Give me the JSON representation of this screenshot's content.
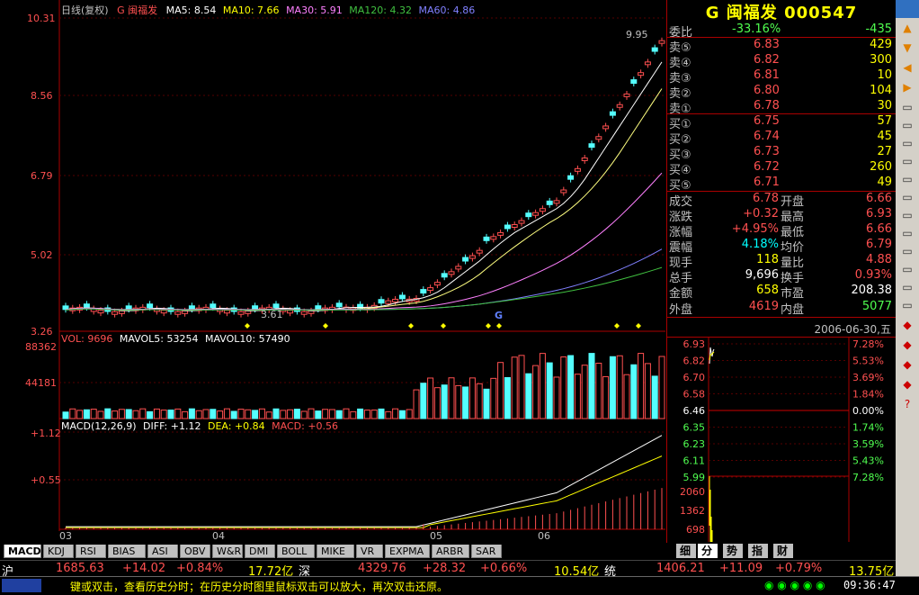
{
  "kline_header": {
    "period": "日线(复权)",
    "name": "G 闽福发",
    "ma5": "MA5: 8.54",
    "ma10": "MA10: 7.66",
    "ma30": "MA30: 5.91",
    "ma120": "MA120: 4.32",
    "ma60": "MA60: 4.86"
  },
  "price_axis": [
    "10.31",
    "8.56",
    "6.79",
    "5.02",
    "3.26"
  ],
  "annotations": {
    "high": "9.95",
    "low": "3.61",
    "g_mark": "G"
  },
  "vol_header": {
    "vol": "VOL: 9696",
    "mavol5": "MAVOL5: 53254",
    "mavol10": "MAVOL10: 57490"
  },
  "vol_axis": [
    "88362",
    "44181"
  ],
  "macd_header": {
    "title": "MACD(12,26,9)",
    "diff": "DIFF: +1.12",
    "dea": "DEA: +0.84",
    "macd": "MACD: +0.56"
  },
  "macd_axis": [
    "+1.12",
    "+0.55"
  ],
  "date_axis": [
    "03",
    "04",
    "05",
    "06"
  ],
  "indicator_tabs": [
    "MACD",
    "KDJ",
    "RSI",
    "BIAS",
    "ASI",
    "OBV",
    "W&R",
    "DMI",
    "BOLL",
    "MIKE",
    "VR",
    "EXPMA",
    "ARBR",
    "SAR"
  ],
  "quote": {
    "title": "G 闽福发 000547",
    "weibi": {
      "label": "委比",
      "value": "-33.16%",
      "diff": "-435"
    },
    "asks": [
      {
        "label": "卖⑤",
        "price": "6.83",
        "vol": "429"
      },
      {
        "label": "卖④",
        "price": "6.82",
        "vol": "300"
      },
      {
        "label": "卖③",
        "price": "6.81",
        "vol": "10"
      },
      {
        "label": "卖②",
        "price": "6.80",
        "vol": "104"
      },
      {
        "label": "卖①",
        "price": "6.78",
        "vol": "30"
      }
    ],
    "bids": [
      {
        "label": "买①",
        "price": "6.75",
        "vol": "57"
      },
      {
        "label": "买②",
        "price": "6.74",
        "vol": "45"
      },
      {
        "label": "买③",
        "price": "6.73",
        "vol": "27"
      },
      {
        "label": "买④",
        "price": "6.72",
        "vol": "260"
      },
      {
        "label": "买⑤",
        "price": "6.71",
        "vol": "49"
      }
    ],
    "stats": [
      {
        "l1": "成交",
        "v1": "6.78",
        "l2": "开盘",
        "v2": "6.66"
      },
      {
        "l1": "涨跌",
        "v1": "+0.32",
        "l2": "最高",
        "v2": "6.93"
      },
      {
        "l1": "涨幅",
        "v1": "+4.95%",
        "l2": "最低",
        "v2": "6.66"
      },
      {
        "l1": "震幅",
        "v1": "4.18%",
        "l2": "均价",
        "v2": "6.79"
      },
      {
        "l1": "现手",
        "v1": "118",
        "l2": "量比",
        "v2": "4.88"
      },
      {
        "l1": "总手",
        "v1": "9,696",
        "l2": "换手",
        "v2": "0.93%"
      },
      {
        "l1": "金额",
        "v1": "658",
        "l2": "市盈",
        "v2": "208.38"
      }
    ],
    "outer": {
      "l1": "外盘",
      "v1": "4619",
      "l2": "内盘",
      "v2": "5077"
    }
  },
  "mini_chart": {
    "date": "2006-06-30,五",
    "prices": [
      "6.93",
      "6.82",
      "6.70",
      "6.58",
      "6.46",
      "6.35",
      "6.23",
      "6.11",
      "5.99"
    ],
    "pcts": [
      "7.28%",
      "5.53%",
      "3.69%",
      "1.84%",
      "0.00%",
      "1.74%",
      "3.59%",
      "5.43%",
      "7.28%"
    ],
    "vols": [
      "2060",
      "1362",
      "698"
    ]
  },
  "right_tabs": [
    "细",
    "分",
    "势",
    "指",
    "财"
  ],
  "status": {
    "sh_label": "沪",
    "sh_index": "1685.63",
    "sh_chg": "+14.02",
    "sh_pct": "+0.84%",
    "sh_amt": "17.72亿",
    "sz_label": "深",
    "sz_index": "4329.76",
    "sz_chg": "+28.32",
    "sz_pct": "+0.66%",
    "sz_amt": "10.54亿",
    "tt_label": "统",
    "tt_index": "1406.21",
    "tt_chg": "+11.09",
    "tt_pct": "+0.79%",
    "tt_amt": "13.75亿"
  },
  "infobar": {
    "tip": "键或双击，查看历史分时；在历史分时图里鼠标双击可以放大，再次双击还原。",
    "time": "09:36:47"
  },
  "colors": {
    "up": "#ff5050",
    "down": "#54ffff",
    "ma5": "#ffffff",
    "ma10": "#ffff80",
    "ma30": "#ff80ff",
    "ma60": "#8080ff",
    "ma120": "#40c040"
  }
}
